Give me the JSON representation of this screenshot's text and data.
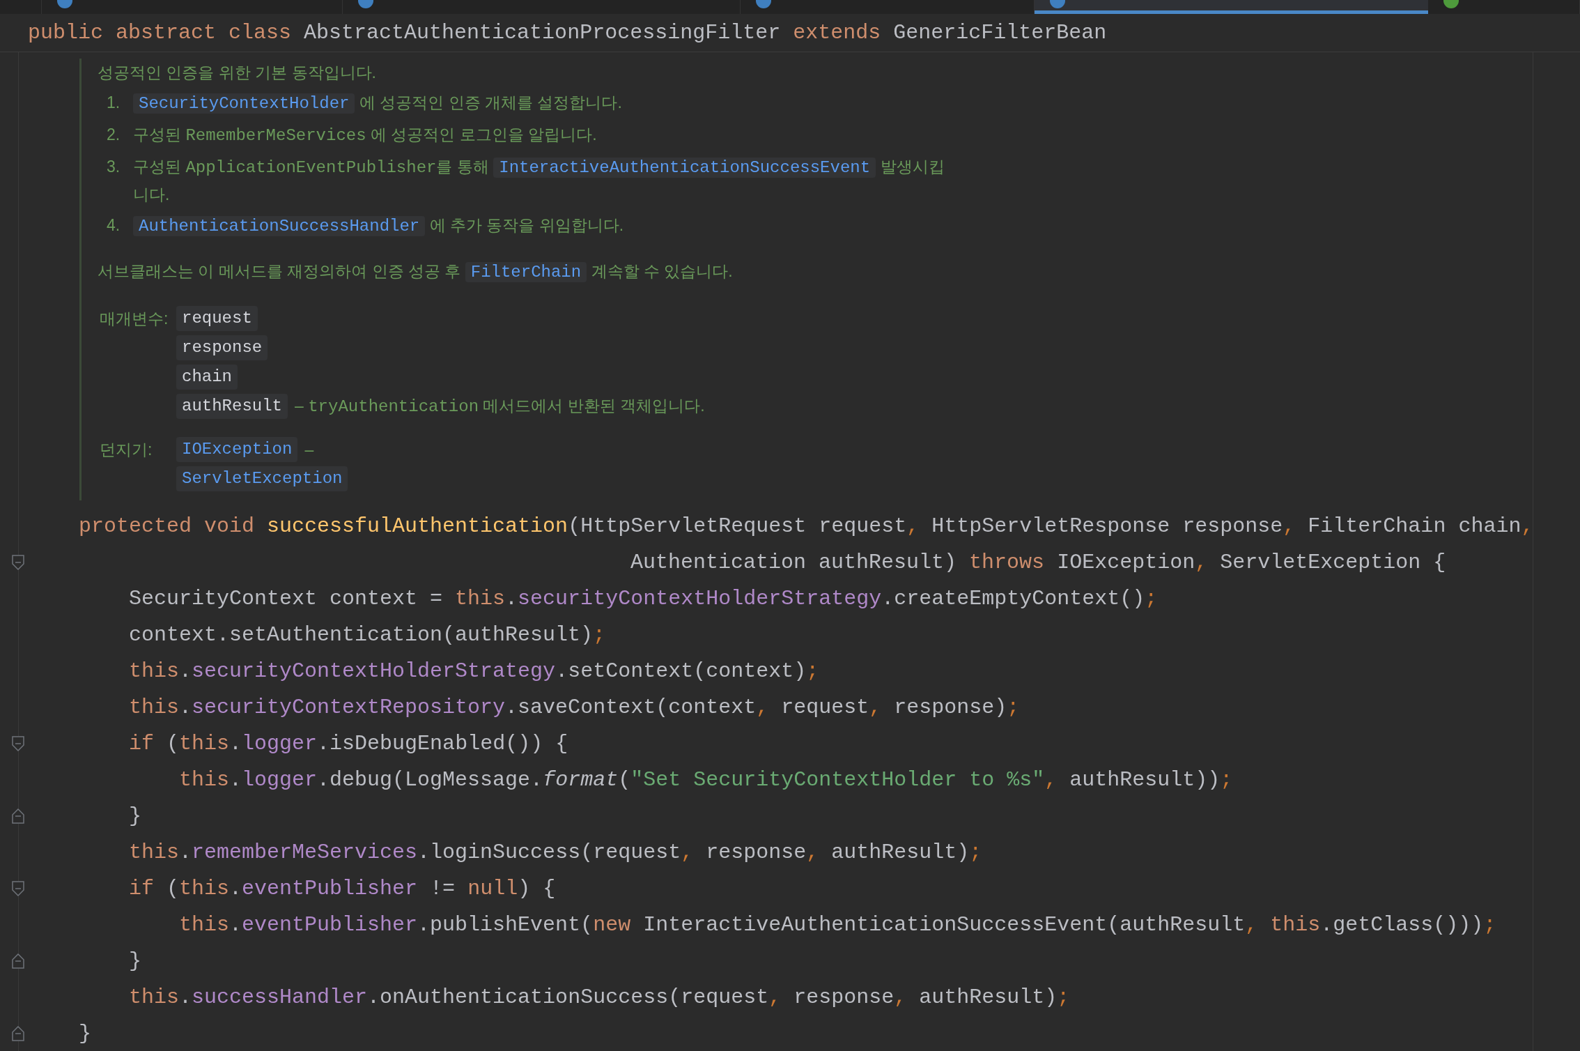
{
  "tabs": [
    {
      "selected": false
    },
    {
      "selected": false,
      "color": "#3f7fbf"
    },
    {
      "selected": false,
      "color": "#3f7fbf"
    },
    {
      "selected": false,
      "color": "#3f7fbf"
    },
    {
      "selected": true,
      "color": "#3f7fbf"
    },
    {
      "selected": false,
      "color": "#4e9a3c"
    }
  ],
  "header": [
    {
      "kind": "keyword",
      "text": "public abstract class"
    },
    {
      "kind": "plain",
      "text": " AbstractAuthenticationProcessingFilter "
    },
    {
      "kind": "keyword",
      "text": "extends"
    },
    {
      "kind": "plain",
      "text": " GenericFilterBean"
    }
  ],
  "doc": {
    "summary": "성공적인 인증을 위한 기본 동작입니다.",
    "steps": [
      {
        "number": "1.",
        "segments": [
          {
            "kind": "link",
            "text": "SecurityContextHolder"
          },
          {
            "kind": "text",
            "text": " 에 성공적인 인증 개체를 설정합니다."
          }
        ]
      },
      {
        "number": "2.",
        "segments": [
          {
            "kind": "text",
            "text": "구성된 "
          },
          {
            "kind": "mono",
            "text": "RememberMeServices"
          },
          {
            "kind": "text",
            "text": " 에 성공적인 로그인을 알립니다."
          }
        ]
      },
      {
        "number": "3.",
        "segments": [
          {
            "kind": "text",
            "text": "구성된 "
          },
          {
            "kind": "mono",
            "text": "ApplicationEventPublisher"
          },
          {
            "kind": "text",
            "text": "를 통해 "
          },
          {
            "kind": "link",
            "text": "InteractiveAuthenticationSuccessEvent"
          },
          {
            "kind": "text",
            "text": " 발생시킵"
          },
          {
            "kind": "br"
          },
          {
            "kind": "text",
            "text": "니다."
          }
        ]
      },
      {
        "number": "4.",
        "segments": [
          {
            "kind": "link",
            "text": "AuthenticationSuccessHandler"
          },
          {
            "kind": "text",
            "text": " 에 추가 동작을 위임합니다."
          }
        ]
      }
    ],
    "note": [
      {
        "kind": "text",
        "text": "서브클래스는 이 메서드를 재정의하여 인증 성공 후 "
      },
      {
        "kind": "link",
        "text": "FilterChain"
      },
      {
        "kind": "text",
        "text": " 계속할 수 있습니다."
      }
    ],
    "params_label": "매개변수:",
    "params": [
      {
        "name": "request"
      },
      {
        "name": "response"
      },
      {
        "name": "chain"
      },
      {
        "name": "authResult",
        "description": [
          {
            "kind": "text",
            "text": "– "
          },
          {
            "kind": "mono",
            "text": "tryAuthentication"
          },
          {
            "kind": "text",
            "text": " 메서드에서 반환된 객체입니다."
          }
        ]
      }
    ],
    "throws_label": "던지기:",
    "throws": [
      {
        "name": "IOException",
        "description": "–"
      },
      {
        "name": "ServletException"
      }
    ]
  },
  "code": [
    {
      "kind": "signature",
      "tokens": [
        {
          "kind": "keyword",
          "text": "protected void "
        },
        {
          "kind": "method",
          "text": "successfulAuthentication"
        },
        {
          "kind": "plain",
          "text": "(HttpServletRequest request"
        },
        {
          "kind": "punct",
          "text": ","
        },
        {
          "kind": "plain",
          "text": " HttpServletResponse response"
        },
        {
          "kind": "punct",
          "text": ","
        },
        {
          "kind": "plain",
          "text": " FilterChain chain"
        },
        {
          "kind": "punct",
          "text": ","
        }
      ]
    },
    {
      "kind": "continuation-open",
      "tokens": [
        {
          "kind": "plain",
          "text": "Authentication authResult) "
        },
        {
          "kind": "keyword",
          "text": "throws"
        },
        {
          "kind": "plain",
          "text": " IOException"
        },
        {
          "kind": "punct",
          "text": ","
        },
        {
          "kind": "plain",
          "text": " ServletException {"
        }
      ]
    },
    {
      "kind": "statement",
      "tokens": [
        {
          "kind": "plain",
          "text": "SecurityContext context = "
        },
        {
          "kind": "keyword",
          "text": "this"
        },
        {
          "kind": "plain",
          "text": "."
        },
        {
          "kind": "field",
          "text": "securityContextHolderStrategy"
        },
        {
          "kind": "plain",
          "text": ".createEmptyContext()"
        },
        {
          "kind": "punct",
          "text": ";"
        }
      ]
    },
    {
      "kind": "statement",
      "tokens": [
        {
          "kind": "plain",
          "text": "context.setAuthentication(authResult)"
        },
        {
          "kind": "punct",
          "text": ";"
        }
      ]
    },
    {
      "kind": "statement",
      "tokens": [
        {
          "kind": "keyword",
          "text": "this"
        },
        {
          "kind": "plain",
          "text": "."
        },
        {
          "kind": "field",
          "text": "securityContextHolderStrategy"
        },
        {
          "kind": "plain",
          "text": ".setContext(context)"
        },
        {
          "kind": "punct",
          "text": ";"
        }
      ]
    },
    {
      "kind": "statement",
      "tokens": [
        {
          "kind": "keyword",
          "text": "this"
        },
        {
          "kind": "plain",
          "text": "."
        },
        {
          "kind": "field",
          "text": "securityContextRepository"
        },
        {
          "kind": "plain",
          "text": ".saveContext(context"
        },
        {
          "kind": "punct",
          "text": ","
        },
        {
          "kind": "plain",
          "text": " request"
        },
        {
          "kind": "punct",
          "text": ","
        },
        {
          "kind": "plain",
          "text": " response)"
        },
        {
          "kind": "punct",
          "text": ";"
        }
      ]
    },
    {
      "kind": "block-open",
      "tokens": [
        {
          "kind": "keyword",
          "text": "if"
        },
        {
          "kind": "plain",
          "text": " ("
        },
        {
          "kind": "keyword",
          "text": "this"
        },
        {
          "kind": "plain",
          "text": "."
        },
        {
          "kind": "field",
          "text": "logger"
        },
        {
          "kind": "plain",
          "text": ".isDebugEnabled()) {"
        }
      ]
    },
    {
      "kind": "nested",
      "tokens": [
        {
          "kind": "keyword",
          "text": "this"
        },
        {
          "kind": "plain",
          "text": "."
        },
        {
          "kind": "field",
          "text": "logger"
        },
        {
          "kind": "plain",
          "text": ".debug(LogMessage."
        },
        {
          "kind": "italic",
          "text": "format"
        },
        {
          "kind": "plain",
          "text": "("
        },
        {
          "kind": "string",
          "text": "\"Set SecurityContextHolder to %s\""
        },
        {
          "kind": "punct",
          "text": ","
        },
        {
          "kind": "plain",
          "text": " authResult))"
        },
        {
          "kind": "punct",
          "text": ";"
        }
      ]
    },
    {
      "kind": "block-close",
      "tokens": [
        {
          "kind": "plain",
          "text": "}"
        }
      ]
    },
    {
      "kind": "statement",
      "tokens": [
        {
          "kind": "keyword",
          "text": "this"
        },
        {
          "kind": "plain",
          "text": "."
        },
        {
          "kind": "field",
          "text": "rememberMeServices"
        },
        {
          "kind": "plain",
          "text": ".loginSuccess(request"
        },
        {
          "kind": "punct",
          "text": ","
        },
        {
          "kind": "plain",
          "text": " response"
        },
        {
          "kind": "punct",
          "text": ","
        },
        {
          "kind": "plain",
          "text": " authResult)"
        },
        {
          "kind": "punct",
          "text": ";"
        }
      ]
    },
    {
      "kind": "block-open",
      "tokens": [
        {
          "kind": "keyword",
          "text": "if"
        },
        {
          "kind": "plain",
          "text": " ("
        },
        {
          "kind": "keyword",
          "text": "this"
        },
        {
          "kind": "plain",
          "text": "."
        },
        {
          "kind": "field",
          "text": "eventPublisher"
        },
        {
          "kind": "plain",
          "text": " != "
        },
        {
          "kind": "keyword",
          "text": "null"
        },
        {
          "kind": "plain",
          "text": ") {"
        }
      ]
    },
    {
      "kind": "nested",
      "tokens": [
        {
          "kind": "keyword",
          "text": "this"
        },
        {
          "kind": "plain",
          "text": "."
        },
        {
          "kind": "field",
          "text": "eventPublisher"
        },
        {
          "kind": "plain",
          "text": ".publishEvent("
        },
        {
          "kind": "keyword",
          "text": "new"
        },
        {
          "kind": "plain",
          "text": " InteractiveAuthenticationSuccessEvent(authResult"
        },
        {
          "kind": "punct",
          "text": ", "
        },
        {
          "kind": "keyword",
          "text": "this"
        },
        {
          "kind": "plain",
          "text": ".getClass()))"
        },
        {
          "kind": "punct",
          "text": ";"
        }
      ]
    },
    {
      "kind": "block-close",
      "tokens": [
        {
          "kind": "plain",
          "text": "}"
        }
      ]
    },
    {
      "kind": "statement",
      "tokens": [
        {
          "kind": "keyword",
          "text": "this"
        },
        {
          "kind": "plain",
          "text": "."
        },
        {
          "kind": "field",
          "text": "successHandler"
        },
        {
          "kind": "plain",
          "text": ".onAuthenticationSuccess(request"
        },
        {
          "kind": "punct",
          "text": ","
        },
        {
          "kind": "plain",
          "text": " response"
        },
        {
          "kind": "punct",
          "text": ","
        },
        {
          "kind": "plain",
          "text": " authResult)"
        },
        {
          "kind": "punct",
          "text": ";"
        }
      ]
    },
    {
      "kind": "method-close",
      "tokens": [
        {
          "kind": "plain",
          "text": "}"
        }
      ]
    }
  ]
}
